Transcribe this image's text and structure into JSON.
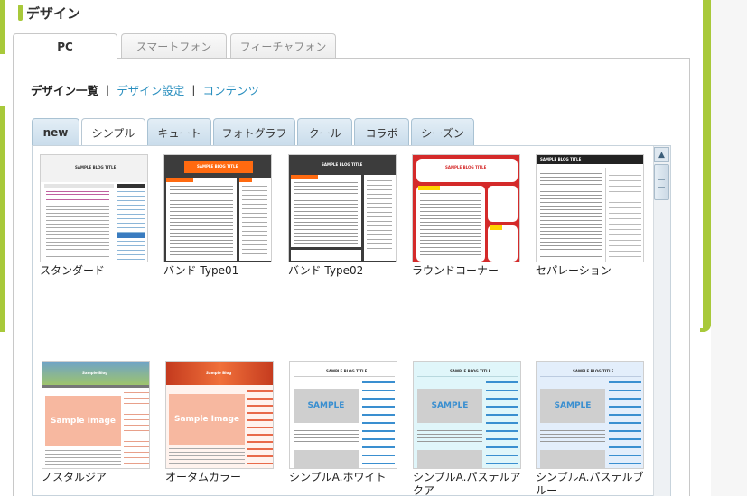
{
  "section": {
    "title": "デザイン"
  },
  "device_tabs": [
    {
      "label": "PC",
      "active": true
    },
    {
      "label": "スマートフォン",
      "active": false
    },
    {
      "label": "フィーチャフォン",
      "active": false
    }
  ],
  "subnav": {
    "current": "デザイン一覧",
    "separator": "|",
    "links": [
      "デザイン設定",
      "コンテンツ"
    ]
  },
  "category_tabs": [
    {
      "label": "new",
      "active": false
    },
    {
      "label": "シンプル",
      "active": true
    },
    {
      "label": "キュート",
      "active": false
    },
    {
      "label": "フォトグラフ",
      "active": false
    },
    {
      "label": "クール",
      "active": false
    },
    {
      "label": "コラボ",
      "active": false
    },
    {
      "label": "シーズン",
      "active": false
    }
  ],
  "designs": [
    {
      "name": "スタンダード",
      "thumb_title": "SAMPLE BLOG TITLE",
      "colors": {
        "bg": "#ffffff",
        "header": "#f2f2f2",
        "accent": "#3a7cc0"
      }
    },
    {
      "name": "バンド Type01",
      "thumb_title": "SAMPLE BLOG TITLE",
      "colors": {
        "bg": "#3c3c3c",
        "header": "#ff6a10",
        "accent": "#ff6a10"
      }
    },
    {
      "name": "バンド Type02",
      "thumb_title": "SAMPLE BLOG TITLE",
      "colors": {
        "bg": "#3c3c3c",
        "header": "#3c3c3c",
        "accent": "#ff6a10"
      }
    },
    {
      "name": "ラウンドコーナー",
      "thumb_title": "SAMPLE BLOG TITLE",
      "colors": {
        "bg": "#d42a2a",
        "header": "#d42a2a",
        "accent": "#ffd400"
      }
    },
    {
      "name": "セパレーション",
      "thumb_title": "SAMPLE BLOG TITLE",
      "colors": {
        "bg": "#ffffff",
        "header": "#222222",
        "accent": "#444444"
      }
    },
    {
      "name": "ノスタルジア",
      "thumb_title": "Sample Blog",
      "sample_text": "Sample Image",
      "colors": {
        "bg": "#ffffff",
        "header": "#6fa3c7",
        "accent": "#f7b8a0"
      }
    },
    {
      "name": "オータムカラー",
      "thumb_title": "Sample Blog",
      "sample_text": "Sample Image",
      "colors": {
        "bg": "#fff3ee",
        "header": "#e8553a",
        "accent": "#f7b8a0"
      }
    },
    {
      "name": "シンプルA.ホワイト",
      "thumb_title": "SAMPLE BLOG TITLE",
      "sample_text": "SAMPLE",
      "colors": {
        "bg": "#ffffff",
        "header": "#ffffff",
        "accent": "#3a8fd0"
      }
    },
    {
      "name": "シンプルA.パステルアクア",
      "thumb_title": "SAMPLE BLOG TITLE",
      "sample_text": "SAMPLE",
      "colors": {
        "bg": "#e0f6fa",
        "header": "#e0f6fa",
        "accent": "#3a8fd0"
      }
    },
    {
      "name": "シンプルA.パステルブルー",
      "thumb_title": "SAMPLE BLOG TITLE",
      "sample_text": "SAMPLE",
      "colors": {
        "bg": "#e3eefb",
        "header": "#e3eefb",
        "accent": "#3a8fd0"
      }
    }
  ]
}
